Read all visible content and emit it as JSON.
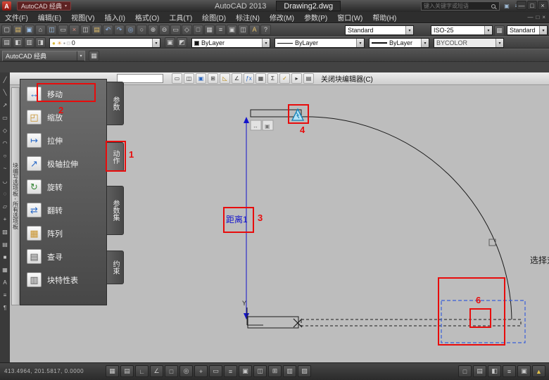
{
  "title_bar": {
    "logo_letter": "A",
    "workspace": "AutoCAD 经典",
    "app_name": "AutoCAD 2013",
    "doc_name": "Drawing2.dwg",
    "search_placeholder": "键入关键字或短语",
    "mini_icons": [
      "▣",
      "≡"
    ],
    "min": "—",
    "max": "□",
    "close": "×"
  },
  "menu_bar": {
    "items": [
      "文件(F)",
      "编辑(E)",
      "视图(V)",
      "插入(I)",
      "格式(O)",
      "工具(T)",
      "绘图(D)",
      "标注(N)",
      "修改(M)",
      "参数(P)",
      "窗口(W)",
      "帮助(H)"
    ],
    "win_min": "—",
    "win_restore": "□",
    "win_close": "×"
  },
  "ui_icons": {
    "dropdown_arrow": "▾"
  },
  "toolbar1": {
    "icons": [
      "▢",
      "▤",
      "▣",
      "⌂",
      "◫",
      "▭",
      "×",
      "◫",
      "▤",
      "↶",
      "↷",
      "◎",
      "○",
      "⊕",
      "⊖",
      "▭",
      "◇",
      "□",
      "▦",
      "≡",
      "▣",
      "◫",
      "A",
      "?"
    ],
    "text_style": "Standard",
    "dim_style": "ISO-25",
    "table_icon": "▦",
    "table_style": "Standard"
  },
  "toolbar2": {
    "icons_left": [
      "▤",
      "◧",
      "▥",
      "◨"
    ],
    "layer_icons": [
      "●",
      "☀",
      "▪",
      "■"
    ],
    "layer_name": "0",
    "icons_right": [
      "▣",
      "◩"
    ],
    "color": "ByLayer",
    "linetype": "ByLayer",
    "lineweight": "ByLayer",
    "plot_style": "BYCOLOR"
  },
  "workspace_bar": {
    "value": "AutoCAD 经典",
    "icon": "▦"
  },
  "block_editor_bar": {
    "icons": [
      "▭",
      "◫",
      "▣",
      "⊞",
      "◺",
      "∠",
      "ƒx",
      "▦",
      "Σ",
      "✓",
      "▸",
      "▤"
    ],
    "close_label": "关闭块编辑器(C)"
  },
  "draw_toolbar": {
    "icons": [
      "╱",
      "╲",
      "↗",
      "▭",
      "◇",
      "◠",
      "○",
      "~",
      "◡",
      "◌",
      "▱",
      "+",
      "▨",
      "▤",
      "■",
      "▦",
      "A",
      "≡",
      "¶"
    ]
  },
  "palette": {
    "side_title": "块编写选项板 - 所有选项板",
    "tabs": [
      "参数",
      "动作",
      "参数集",
      "约束"
    ],
    "items": [
      {
        "icon": "↔",
        "label": "移动"
      },
      {
        "icon": "◰",
        "label": "缩放"
      },
      {
        "icon": "↦",
        "label": "拉伸"
      },
      {
        "icon": "↗",
        "label": "极轴拉伸"
      },
      {
        "icon": "↻",
        "label": "旋转"
      },
      {
        "icon": "⇄",
        "label": "翻转"
      },
      {
        "icon": "▦",
        "label": "阵列"
      },
      {
        "icon": "▤",
        "label": "查寻"
      },
      {
        "icon": "▥",
        "label": "块特性表"
      }
    ]
  },
  "canvas": {
    "dim_label": "距离1",
    "ucs_y_label": "Y",
    "select_prompt": "选择对象",
    "ghost_move_icon": "↔",
    "ghost_copy_icon": "▣"
  },
  "annotations": {
    "n1": "1",
    "n2": "2",
    "n3": "3",
    "n4": "4",
    "n6": "6"
  },
  "status_bar": {
    "coords": "413.4964, 201.5817, 0.0000",
    "left_buttons": [
      "▦",
      "▤",
      "∟",
      "∠",
      "□",
      "◎",
      "+",
      "▭",
      "≡",
      "▣",
      "◫",
      "⊞",
      "▥",
      "▨"
    ],
    "right_buttons": [
      "□",
      "▤",
      "◧",
      "≡",
      "▣",
      "▲"
    ]
  }
}
